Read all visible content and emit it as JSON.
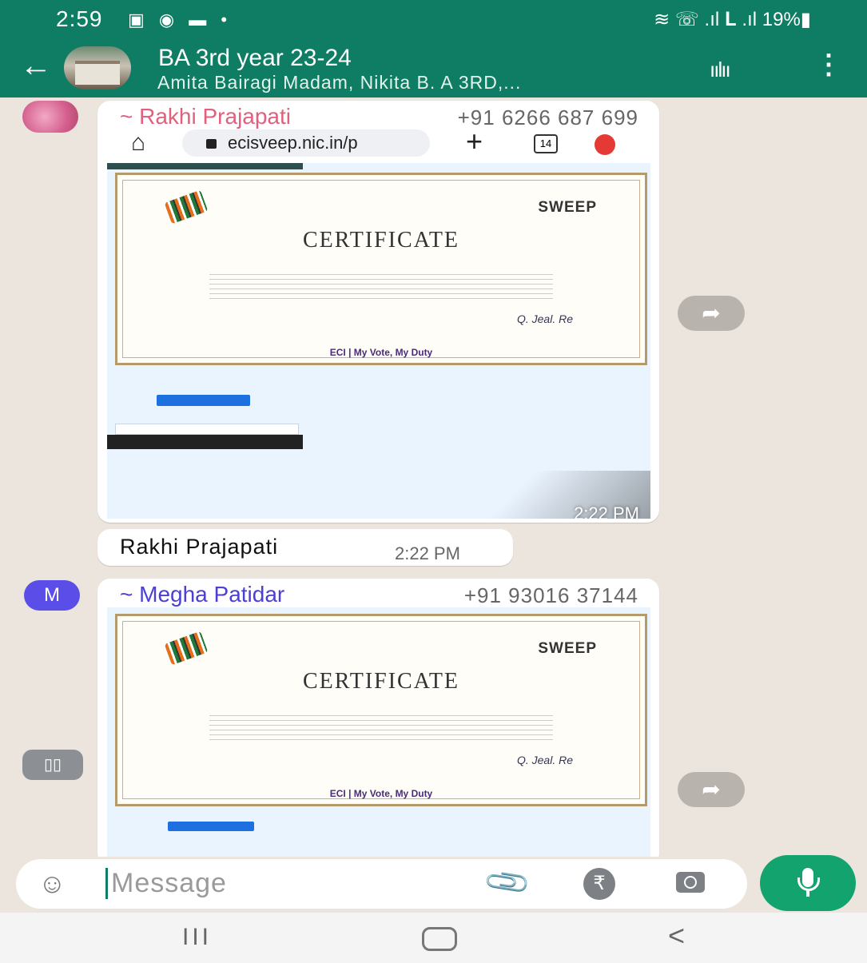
{
  "status_bar": {
    "time": "2:59",
    "notification_icons": "▣ ◉ ▬ •",
    "indicators": "≋ ☏ .ıl 𝐋 .ıl",
    "battery": "19%▮"
  },
  "header": {
    "back_glyph": "←",
    "title": "BA 3rd year 23-24",
    "subtitle": "Amita Bairagi Madam, Nikita B. A 3RD,...",
    "voice_glyph": "ıılıı",
    "menu_glyph": "⋮"
  },
  "messages": [
    {
      "sender": "~ Rakhi Prajapati",
      "phone": "+91 6266 687 699",
      "sender_color": "#e0607e",
      "browser_url": "ecisveep.nic.in/p",
      "browser_tab_count": "14",
      "certificate_logo_text": "SWEEP",
      "certificate_title": "CERTIFICATE",
      "certificate_footer": "ECI | My Vote, My Duty",
      "certificate_signature": "Q. Jeal. Re",
      "time": "2:22 PM"
    },
    {
      "text": "Rakhi Prajapati",
      "time": "2:22 PM"
    },
    {
      "sender": "~ Megha Patidar",
      "phone": "+91 93016 37144",
      "sender_color": "#4b3fd6",
      "avatar_letter": "M",
      "certificate_logo_text": "SWEEP",
      "certificate_title": "CERTIFICATE",
      "certificate_footer": "ECI | My Vote, My Duty",
      "certificate_signature": "Q. Jeal. Re"
    }
  ],
  "input": {
    "placeholder": "Message",
    "emoji_glyph": "☺",
    "attach_glyph": "📎",
    "rupee_glyph": "₹"
  },
  "nav": {
    "recent_glyph": "III",
    "back_glyph": "<"
  },
  "colors": {
    "brand_green": "#0f7d63",
    "mic_green": "#13a36f",
    "chat_bg": "#ece5dd"
  }
}
